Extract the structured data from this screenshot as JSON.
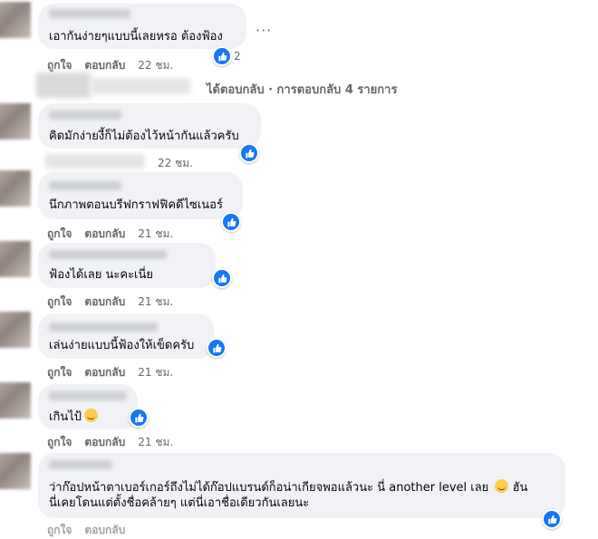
{
  "labels": {
    "like": "ถูกใจ",
    "reply": "ตอบกลับ"
  },
  "replies_summary": "ได้ตอบกลับ · การตอบกลับ 4 รายการ",
  "more_options": "···",
  "comments": [
    {
      "text": "เอากันง่ายๆแบบนี้เลยหรอ ต้องฟ้อง",
      "likes": "2",
      "time": "22 ชม."
    },
    {
      "text": "คิดมักง่ายงี้ก็ไม่ต้องไว้หน้ากันแล้วครับ",
      "time": "22 ชม."
    },
    {
      "text": "นึกภาพตอนบรีฟกราฟฟิคดีไซเนอร์",
      "time": "21 ชม."
    },
    {
      "text": "ฟ้องได้เลย นะคะเนี่ย",
      "time": "21 ชม."
    },
    {
      "text": "เล่นง่ายแบบนี้ฟ้องให้เข็ดครับ",
      "time": "21 ชม."
    },
    {
      "text": "เกินไป้",
      "time": "21 ชม."
    },
    {
      "line1": "ว่าก๊อปหน้าตาเบอร์เกอร์ถึงไม่ได้ก๊อปแบรนด์ก็อน่าเกียจพอแล้วนะ นี่ another level เลย",
      "line1_end": "ฮัน",
      "line2": "นี่เคยโดนแต่ตั้งชื่อคล้ายๆ แต่นี่เอาชื่อเดียวกันเลยนะ"
    }
  ],
  "icons": {
    "like": "thumbs-up-icon",
    "emoji": "grinning-face-icon",
    "more": "more-dots-icon"
  },
  "colors": {
    "bubble": "#f0f2f5",
    "like_blue": "#1877f2",
    "meta_gray": "#65676b"
  }
}
